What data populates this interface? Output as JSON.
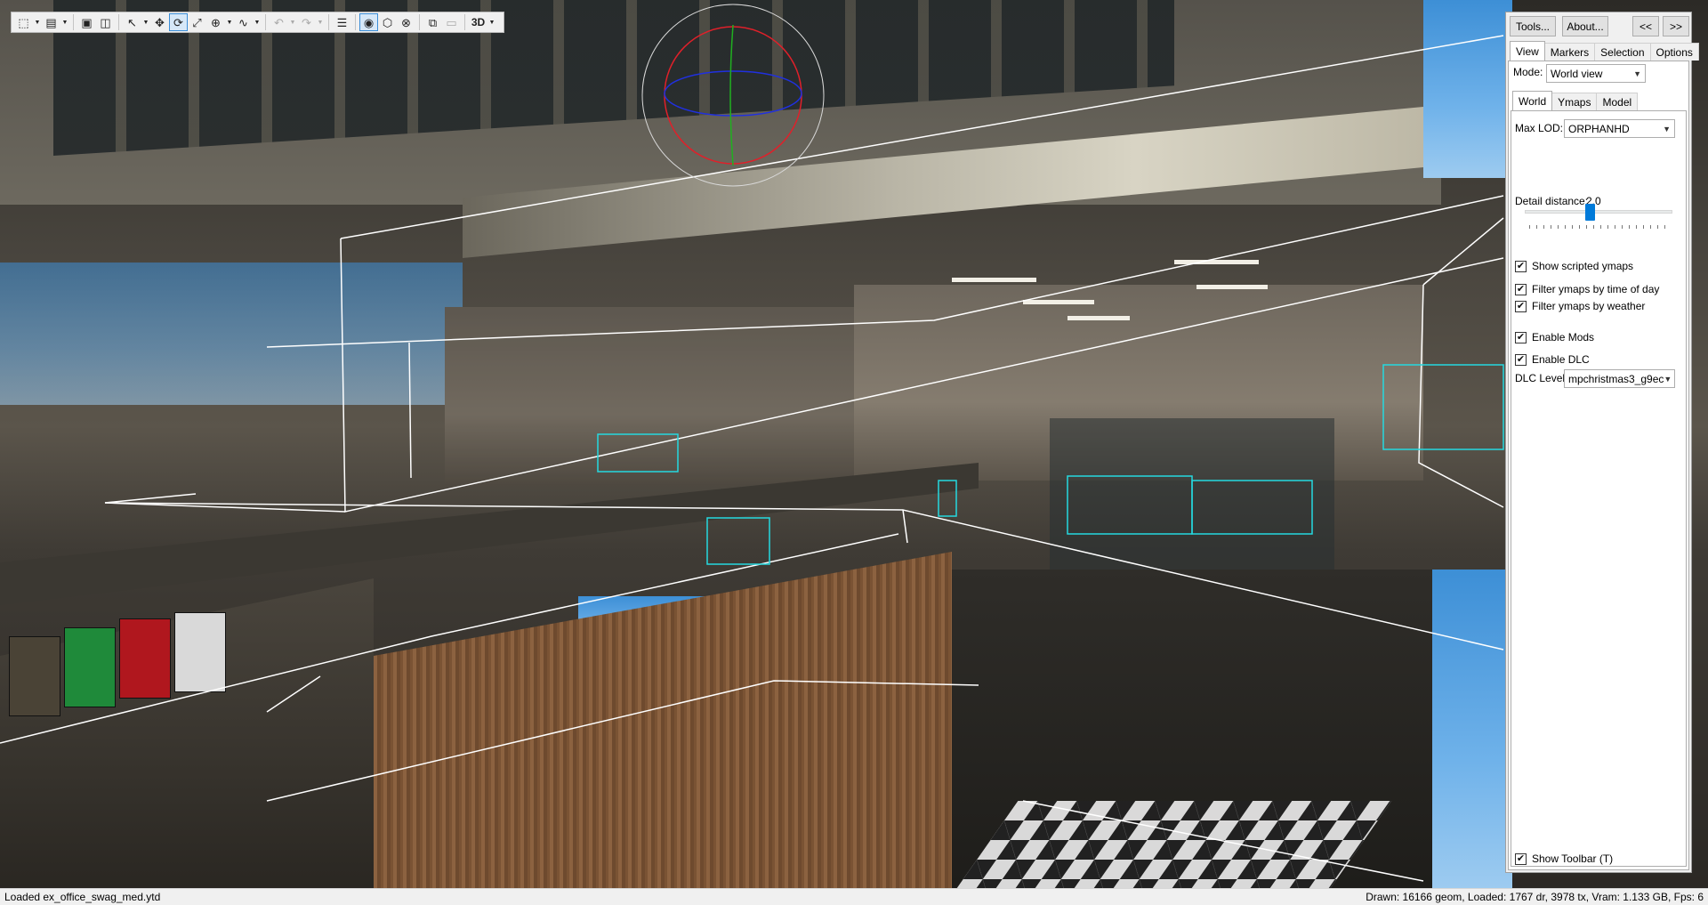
{
  "toolbar": {
    "buttons": [
      {
        "icon": "new-icon",
        "glyph": "⬚",
        "dropdown": true
      },
      {
        "icon": "open-icon",
        "glyph": "▤",
        "dropdown": true
      },
      {
        "icon": "save-icon",
        "glyph": "▣"
      },
      {
        "icon": "save-all-icon",
        "glyph": "◫"
      },
      {
        "icon": "pointer-icon",
        "glyph": "↖",
        "dropdown": true
      },
      {
        "icon": "move-icon",
        "glyph": "✥"
      },
      {
        "icon": "rotate-icon",
        "glyph": "⟳",
        "active": true
      },
      {
        "icon": "scale-icon",
        "glyph": "⤢",
        "dropdown": false
      },
      {
        "icon": "world-space-icon",
        "glyph": "⊕",
        "dropdown": true
      },
      {
        "icon": "snap-icon",
        "glyph": "∿",
        "dropdown": true
      },
      {
        "icon": "undo-icon",
        "glyph": "↶",
        "dropdown": true,
        "disabled": true
      },
      {
        "icon": "redo-icon",
        "glyph": "↷",
        "dropdown": true,
        "disabled": true
      },
      {
        "icon": "info-window-icon",
        "glyph": "☰"
      },
      {
        "icon": "wireframe-icon",
        "glyph": "◉",
        "active": true
      },
      {
        "icon": "show-collisions-icon",
        "glyph": "⬡"
      },
      {
        "icon": "hide-collisions-icon",
        "glyph": "⊗"
      },
      {
        "icon": "copy-icon",
        "glyph": "⧉"
      },
      {
        "icon": "paste-icon",
        "glyph": "▭",
        "disabled": true
      },
      {
        "icon": "mode-3d-icon",
        "text": "3D",
        "dropdown": true
      }
    ]
  },
  "panel": {
    "tools_button": "Tools...",
    "about_button": "About...",
    "collapse_button": "<<",
    "expand_button": ">>",
    "tabs": [
      "View",
      "Markers",
      "Selection",
      "Options"
    ],
    "mode_label": "Mode:",
    "mode_value": "World view",
    "sub_tabs": [
      "World",
      "Ymaps",
      "Model"
    ],
    "max_lod_label": "Max LOD:",
    "max_lod_value": "ORPHANHD",
    "detail_distance_label": "Detail distance:",
    "detail_distance_value": "2.0",
    "detail_distance_fraction": 0.44,
    "checks": {
      "show_scripted_ymaps": {
        "label": "Show scripted ymaps",
        "checked": true
      },
      "filter_time": {
        "label": "Filter ymaps by time of day",
        "checked": true
      },
      "filter_weather": {
        "label": "Filter ymaps by weather",
        "checked": true
      },
      "enable_mods": {
        "label": "Enable Mods",
        "checked": true
      },
      "enable_dlc": {
        "label": "Enable DLC",
        "checked": true
      }
    },
    "dlc_level_label": "DLC Level:",
    "dlc_level_value": "mpchristmas3_g9ec",
    "show_toolbar": {
      "label": "Show Toolbar (T)",
      "checked": true
    }
  },
  "statusbar": {
    "left": "Loaded ex_office_swag_med.ytd",
    "right": "Drawn: 16166 geom, Loaded: 1767 dr, 3978 tx, Vram: 1.133 GB, Fps: 6"
  },
  "colors": {
    "gizmo_x": "#e0202a",
    "gizmo_y": "#20b020",
    "gizmo_z": "#2030e0",
    "selection_box": "#ffffff",
    "entity_outline": "#25d9e0"
  }
}
